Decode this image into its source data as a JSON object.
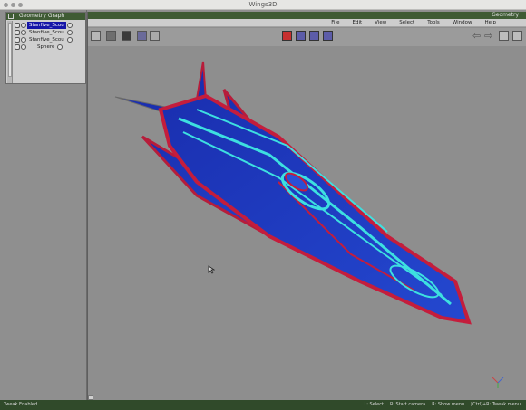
{
  "window": {
    "title": "Wings3D"
  },
  "geometry_graph": {
    "title": "Geometry Graph",
    "items": [
      {
        "name": "Stanfive_Scou",
        "selected": true
      },
      {
        "name": "Stanfive_Scou",
        "selected": false
      },
      {
        "name": "Stanfive_Scou",
        "selected": false
      },
      {
        "name": "Sphere",
        "selected": false
      }
    ]
  },
  "geometry_window": {
    "title": "Geometry",
    "menu": [
      "File",
      "Edit",
      "View",
      "Select",
      "Tools",
      "Window",
      "Help"
    ]
  },
  "toolbar": {
    "left_buttons": [
      "smooth-preview-icon",
      "wireframe-icon",
      "shaded-icon",
      "solid-icon",
      "ortho-icon"
    ],
    "select_mode_buttons": [
      "vertex-mode-icon",
      "edge-mode-icon",
      "face-mode-icon",
      "body-mode-icon"
    ],
    "right_buttons": [
      "undo-arrow-icon",
      "redo-arrow-icon",
      "view-icon",
      "camera-icon"
    ]
  },
  "statusbar": {
    "left": "Tweak Enabled",
    "right": [
      "L: Select",
      "R: Start camera",
      "R: Show menu",
      "[Ctrl]+R: Tweak menu"
    ]
  },
  "colors": {
    "title_bar_green": "#3f5b34",
    "selection_blue": "#1515a8",
    "model_blue": "#1f3bc2",
    "model_red": "#c41d3c",
    "model_cyan": "#3de0e0"
  }
}
